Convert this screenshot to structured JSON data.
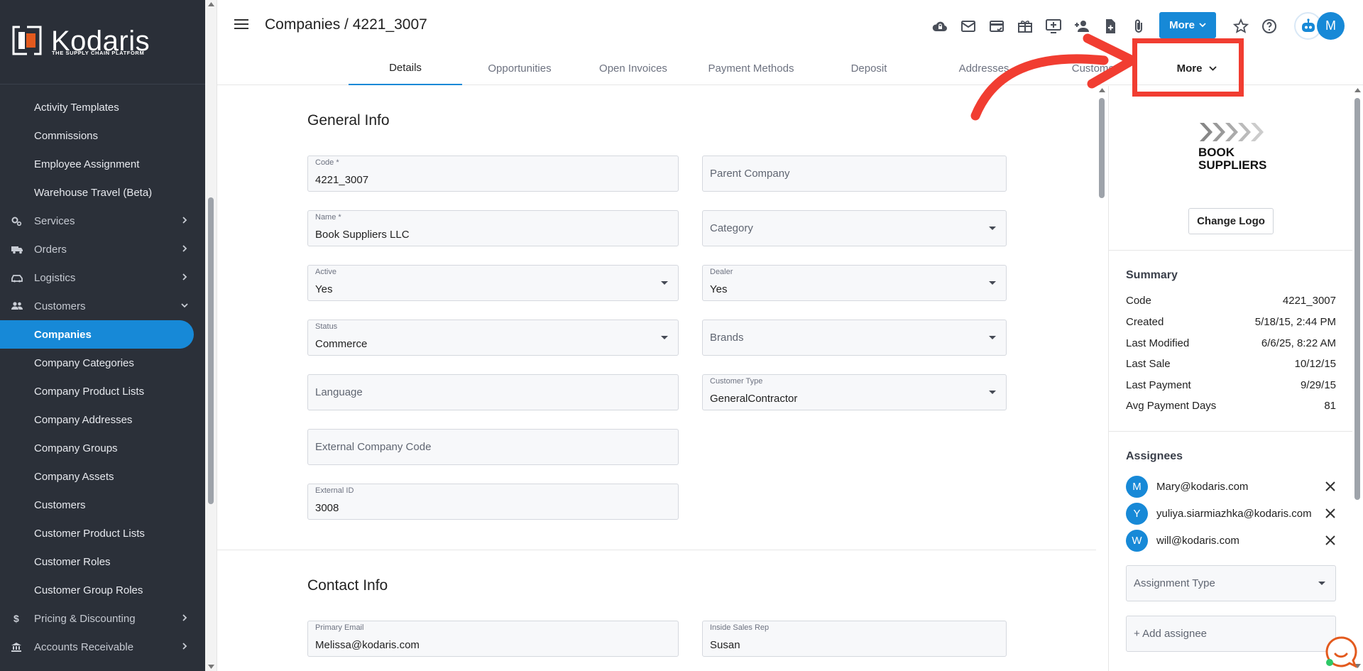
{
  "brand": {
    "name": "Kodaris",
    "tagline": "THE SUPPLY CHAIN PLATFORM",
    "accent_color": "#1789d7",
    "logo_color": "#e35a1e"
  },
  "sidebar": {
    "items": [
      {
        "label": "Activity Templates",
        "kind": "sub"
      },
      {
        "label": "Commissions",
        "kind": "sub"
      },
      {
        "label": "Employee Assignment",
        "kind": "sub"
      },
      {
        "label": "Warehouse Travel (Beta)",
        "kind": "sub"
      },
      {
        "label": "Services",
        "kind": "cat",
        "icon": "gears-icon",
        "chevron": "right"
      },
      {
        "label": "Orders",
        "kind": "cat",
        "icon": "truck-icon",
        "chevron": "right"
      },
      {
        "label": "Logistics",
        "kind": "cat",
        "icon": "car-icon",
        "chevron": "right"
      },
      {
        "label": "Customers",
        "kind": "cat",
        "icon": "people-icon",
        "chevron": "down"
      },
      {
        "label": "Companies",
        "kind": "sub",
        "active": true
      },
      {
        "label": "Company Categories",
        "kind": "sub"
      },
      {
        "label": "Company Product Lists",
        "kind": "sub"
      },
      {
        "label": "Company Addresses",
        "kind": "sub"
      },
      {
        "label": "Company Groups",
        "kind": "sub"
      },
      {
        "label": "Company Assets",
        "kind": "sub"
      },
      {
        "label": "Customers",
        "kind": "sub"
      },
      {
        "label": "Customer Product Lists",
        "kind": "sub"
      },
      {
        "label": "Customer Roles",
        "kind": "sub"
      },
      {
        "label": "Customer Group Roles",
        "kind": "sub"
      },
      {
        "label": "Pricing & Discounting",
        "kind": "cat",
        "icon": "dollar-icon",
        "chevron": "right"
      },
      {
        "label": "Accounts Receivable",
        "kind": "cat",
        "icon": "bank-icon",
        "chevron": "right"
      }
    ]
  },
  "header": {
    "title": "Companies / 4221_3007",
    "more_label": "More",
    "avatar_letter": "M",
    "icons": [
      "cloud-lock-icon",
      "mail-icon",
      "card-check-icon",
      "gift-icon",
      "add-screen-icon",
      "add-person-icon",
      "add-file-icon",
      "paperclip-icon"
    ]
  },
  "tabs": [
    {
      "label": "Details",
      "active": true
    },
    {
      "label": "Opportunities"
    },
    {
      "label": "Open Invoices"
    },
    {
      "label": "Payment Methods"
    },
    {
      "label": "Deposit"
    },
    {
      "label": "Addresses"
    },
    {
      "label": "Customers"
    },
    {
      "label": "More"
    }
  ],
  "general_info": {
    "title": "General Info",
    "code": {
      "label": "Code *",
      "value": "4221_3007"
    },
    "parent_company": {
      "placeholder": "Parent Company"
    },
    "name": {
      "label": "Name *",
      "value": "Book Suppliers LLC"
    },
    "category": {
      "placeholder": "Category"
    },
    "active": {
      "label": "Active",
      "value": "Yes"
    },
    "dealer": {
      "label": "Dealer",
      "value": "Yes"
    },
    "status": {
      "label": "Status",
      "value": "Commerce"
    },
    "brands": {
      "placeholder": "Brands"
    },
    "language": {
      "placeholder": "Language"
    },
    "customer_type": {
      "label": "Customer Type",
      "value": "GeneralContractor"
    },
    "external_company_code": {
      "placeholder": "External Company Code"
    },
    "external_id": {
      "label": "External ID",
      "value": "3008"
    }
  },
  "contact_info": {
    "title": "Contact Info",
    "primary_email": {
      "label": "Primary Email",
      "value": "Melissa@kodaris.com"
    },
    "inside_sales_rep": {
      "label": "Inside Sales Rep",
      "value": "Susan"
    }
  },
  "right_panel": {
    "company_logo_text": [
      "BOOK",
      "SUPPLIERS"
    ],
    "change_logo_label": "Change Logo",
    "summary_title": "Summary",
    "summary": [
      {
        "label": "Code",
        "value": "4221_3007"
      },
      {
        "label": "Created",
        "value": "5/18/15, 2:44 PM"
      },
      {
        "label": "Last Modified",
        "value": "6/6/25, 8:22 AM"
      },
      {
        "label": "Last Sale",
        "value": "10/12/15"
      },
      {
        "label": "Last Payment",
        "value": "9/29/15"
      },
      {
        "label": "Avg Payment Days",
        "value": "81"
      }
    ],
    "assignees_title": "Assignees",
    "assignees": [
      {
        "letter": "M",
        "email": "Mary@kodaris.com"
      },
      {
        "letter": "Y",
        "email": "yuliya.siarmiazhka@kodaris.com"
      },
      {
        "letter": "W",
        "email": "will@kodaris.com"
      }
    ],
    "assignment_type_placeholder": "Assignment Type",
    "add_assignee_placeholder": "+ Add assignee"
  },
  "annotation": {
    "color": "#f13d31"
  }
}
